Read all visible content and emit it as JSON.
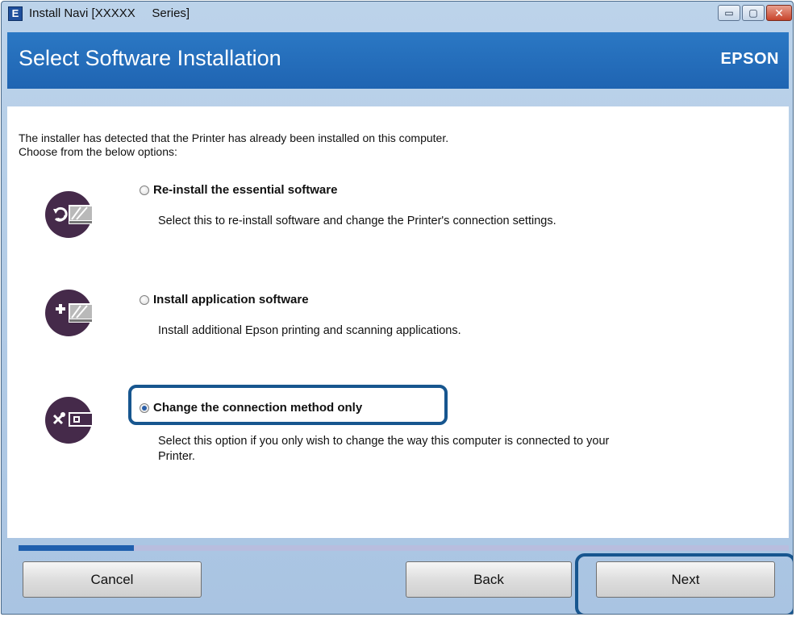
{
  "window": {
    "title_prefix": "Install Navi [",
    "title_model": "XXXXX",
    "title_suffix": "Series]",
    "app_icon_letter": "E",
    "controls": {
      "minimize_icon": "minimize-icon",
      "maximize_icon": "maximize-icon",
      "close_icon": "close-icon",
      "minimize_glyph": "▭",
      "maximize_glyph": "▢",
      "close_glyph": "✕"
    }
  },
  "header": {
    "title": "Select Software Installation",
    "brand": "EPSON",
    "background_color": "#2374c0"
  },
  "intro": {
    "line1": "The installer has detected that the Printer has already been installed on this computer.",
    "line2": "Choose from the below options:"
  },
  "options": [
    {
      "label": "Re-install the essential software",
      "description": "Select this to re-install software and change the Printer's connection settings.",
      "selected": false,
      "icon": "reinstall-printer-icon"
    },
    {
      "label": "Install application software",
      "description": "Install additional Epson printing and scanning applications.",
      "selected": false,
      "icon": "add-application-icon"
    },
    {
      "label": "Change the connection method only",
      "description_line1": "Select this option if you only wish to change the way this computer is connected to your",
      "description_line2": "Printer.",
      "selected": true,
      "icon": "tools-connection-icon"
    }
  ],
  "progress": {
    "fraction": 0.15,
    "fill_color": "#1f5fad",
    "track_color": "#b8bdde"
  },
  "buttons": {
    "cancel": "Cancel",
    "back": "Back",
    "next": "Next"
  },
  "accent_color": "#17568f"
}
